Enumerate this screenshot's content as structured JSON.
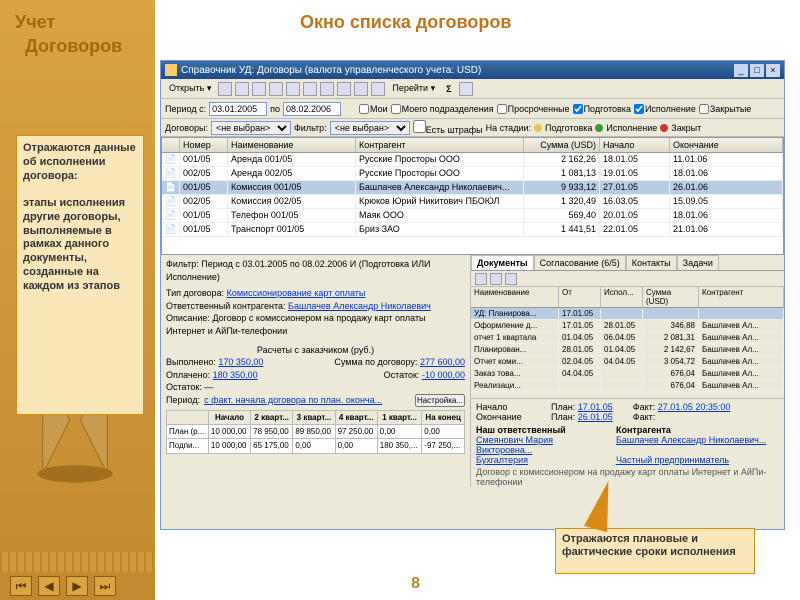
{
  "slide": {
    "section1": "Учет",
    "section2": "Договоров",
    "title": "Окно списка договоров",
    "page": "8",
    "callout1": "Отражаются данные об исполнении договора:\n\nэтапы исполнения другие договоры, выполняемые в рамках данного документы, созданные на каждом из этапов",
    "callout2": "Отражаются плановые и фактические сроки исполнения"
  },
  "window": {
    "title": "Справочник УД: Договоры (валюта управленческого учета: USD)",
    "toolbar": {
      "open": "Открыть",
      "goto": "Перейти",
      "sum": "Σ"
    },
    "filter": {
      "period_label": "Период с:",
      "date_from": "03.01.2005",
      "po": "по",
      "date_to": "08.02.2006",
      "mine": "Мои",
      "mysub": "Моего подразделения",
      "overdue": "Просроченные",
      "prep": "Подготовка",
      "exec": "Исполнение",
      "closed": "Закрытые"
    },
    "filter2": {
      "contracts": "Договоры:",
      "sel1": "<не выбран>",
      "filt": "Фильтр:",
      "sel2": "<не выбран>",
      "fines": "Есть штрафы",
      "stage": "На стадии:",
      "s1": "Подготовка",
      "s2": "Исполнение",
      "s3": "Закрыт"
    },
    "grid": {
      "cols": [
        "",
        "Номер",
        "Наименование",
        "Контрагент",
        "Сумма (USD)",
        "Начало",
        "Окончание"
      ],
      "rows": [
        {
          "num": "001/05",
          "name": "Аренда 001/05",
          "contr": "Русские Просторы ООО",
          "sum": "2 162,26",
          "start": "18.01.05",
          "end": "11.01.06"
        },
        {
          "num": "002/05",
          "name": "Аренда 002/05",
          "contr": "Русские Просторы ООО",
          "sum": "1 081,13",
          "start": "19.01.05",
          "end": "18.01.06"
        },
        {
          "num": "001/05",
          "name": "Комиссия 001/05",
          "contr": "Башлачев Александр Николаевич...",
          "sum": "9 933,12",
          "start": "27.01.05",
          "end": "26.01.06",
          "sel": true
        },
        {
          "num": "002/05",
          "name": "Комиссия 002/05",
          "contr": "Крюков Юрий Никитович ПБОЮЛ",
          "sum": "1 320,49",
          "start": "16.03.05",
          "end": "15.09.05"
        },
        {
          "num": "001/05",
          "name": "Телефон 001/05",
          "contr": "Маяк ООО",
          "sum": "569,40",
          "start": "20.01.05",
          "end": "18.01.06"
        },
        {
          "num": "001/05",
          "name": "Транспорт 001/05",
          "contr": "Бриз ЗАО",
          "sum": "1 441,51",
          "start": "22.01.05",
          "end": "21.01.06"
        }
      ]
    },
    "details": {
      "filter_lbl": "Фильтр:",
      "filter_txt": "Период с 03.01.2005 по 08.02.2006 И (Подготовка ИЛИ Исполнение)",
      "type_lbl": "Тип договора:",
      "type_val": "Комиссионирование карт оплаты",
      "resp_lbl": "Ответственный контрагента:",
      "resp_val": "Башлачев Александр Николаевич",
      "desc_lbl": "Описание:",
      "desc_val": "Договор с комиссионером на продажу карт оплаты Интернет и АйПи-телефонии",
      "calc_title": "Расчеты с заказчиком (руб.)",
      "done_lbl": "Выполнено:",
      "done_val": "170 350,00",
      "dog_lbl": "Сумма по договору:",
      "dog_val": "277 600,00",
      "paid_lbl": "Оплачено:",
      "paid_val": "180 350,00",
      "ost_lbl": "Остаток:",
      "ost_val": "-10 000,00",
      "ost2_lbl": "Остаток:",
      "ost2_val": "—",
      "per_lbl": "Период:",
      "per_val": "с факт. начала договора по план. оконча...",
      "settings": "Настройка...",
      "calc_cols": [
        "",
        "Начало",
        "2 кварт...",
        "3 кварт...",
        "4 кварт...",
        "1 кварт...",
        "На конец"
      ],
      "calc_rows": [
        [
          "План (р...",
          "10 000,00",
          "78 950,00",
          "89 850,00",
          "97 250,00",
          "0,00",
          "0,00"
        ],
        [
          "Подпи...",
          "10 000,00",
          "65 175,00",
          "0,00",
          "0,00",
          "180 350,...",
          "-97 250,..."
        ]
      ]
    },
    "tabs": {
      "t1": "Документы",
      "t2": "Согласование (6/5)",
      "t3": "Контакты",
      "t4": "Задачи"
    },
    "docs": {
      "cols": [
        "Наименование",
        "От",
        "Испол...",
        "Сумма (USD)",
        "Контрагент"
      ],
      "rows": [
        {
          "name": "УД: Планирова...",
          "dt": "17.01.05",
          "isp": "",
          "sum": "",
          "ctr": "",
          "sel": true
        },
        {
          "name": "Оформление д...",
          "dt": "17.01.05",
          "isp": "28.01.05",
          "sum": "346,88",
          "ctr": "Башлачев Ал..."
        },
        {
          "name": "отчет 1 квартала",
          "dt": "01.04.05",
          "isp": "06.04.05",
          "sum": "2 081,31",
          "ctr": "Башлачев Ал..."
        },
        {
          "name": "Планирован...",
          "dt": "28.01.05",
          "isp": "01.04.05",
          "sum": "2 142,67",
          "ctr": "Башлачев Ал..."
        },
        {
          "name": "Отчет коми...",
          "dt": "02.04.05",
          "isp": "04.04.05",
          "sum": "3 054,72",
          "ctr": "Башлачев Ал..."
        },
        {
          "name": "Заказ това...",
          "dt": "04.04.05",
          "isp": "",
          "sum": "676,04",
          "ctr": "Башлачев Ал..."
        },
        {
          "name": "Реализаци...",
          "dt": "",
          "isp": "",
          "sum": "676,04",
          "ctr": "Башлачев Ал..."
        }
      ]
    },
    "dates": {
      "start_lbl": "Начало",
      "plan1_lbl": "План:",
      "plan1_val": "17.01.05",
      "fact1_lbl": "Факт:",
      "fact1_val": "27.01.05 20:35:00",
      "end_lbl": "Окончание",
      "plan2_lbl": "План:",
      "plan2_val": "26.01.05",
      "fact2_lbl": "Факт:",
      "our_lbl": "Наш ответственный",
      "our_val": "Смеянович Мария Викторовна...",
      "ctr_lbl": "Контрагента",
      "ctr_val": "Башлачев Александр Николаевич...",
      "dept_lbl": "Бухгалтерия",
      "ent_val": "Частный предприниматель",
      "note": "Договор с комиссионером на продажу карт оплаты Интернет и АйПи-телефонии"
    }
  }
}
